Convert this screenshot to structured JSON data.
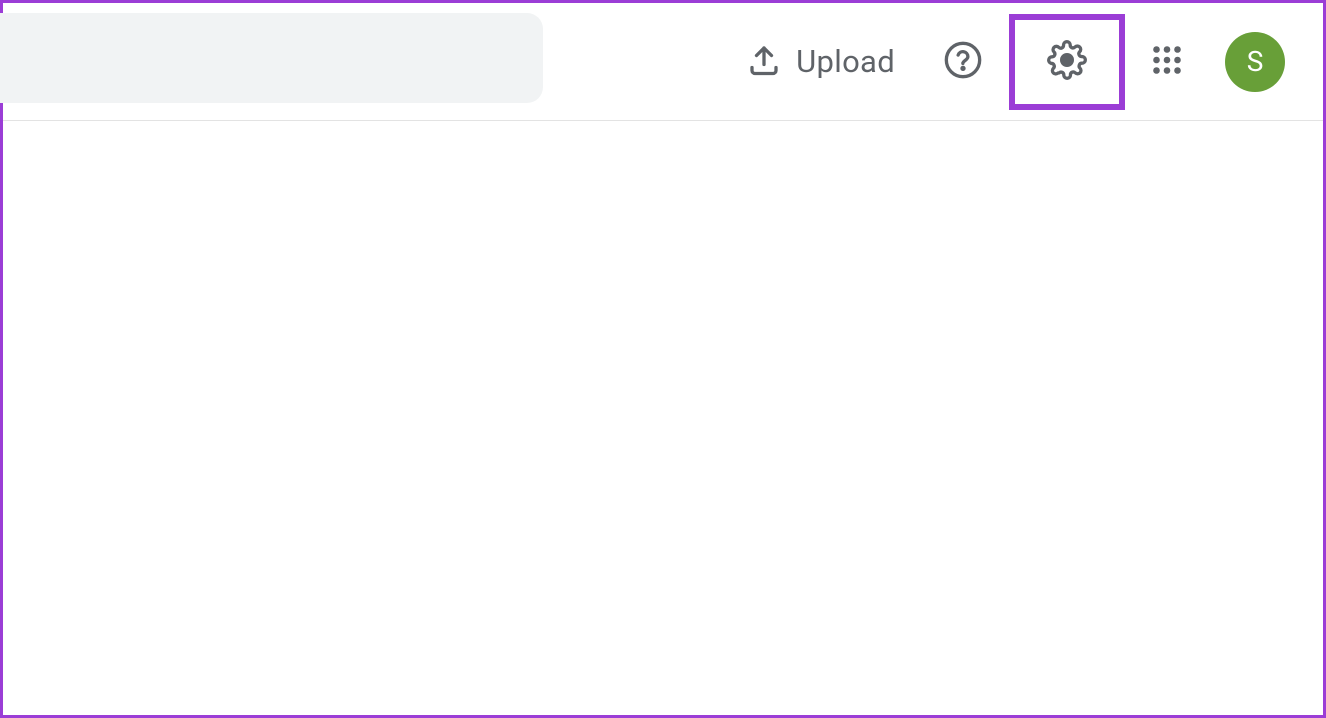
{
  "header": {
    "upload_label": "Upload",
    "avatar_initial": "S",
    "highlight_color": "#9b3dd6",
    "avatar_color": "#689f38"
  }
}
